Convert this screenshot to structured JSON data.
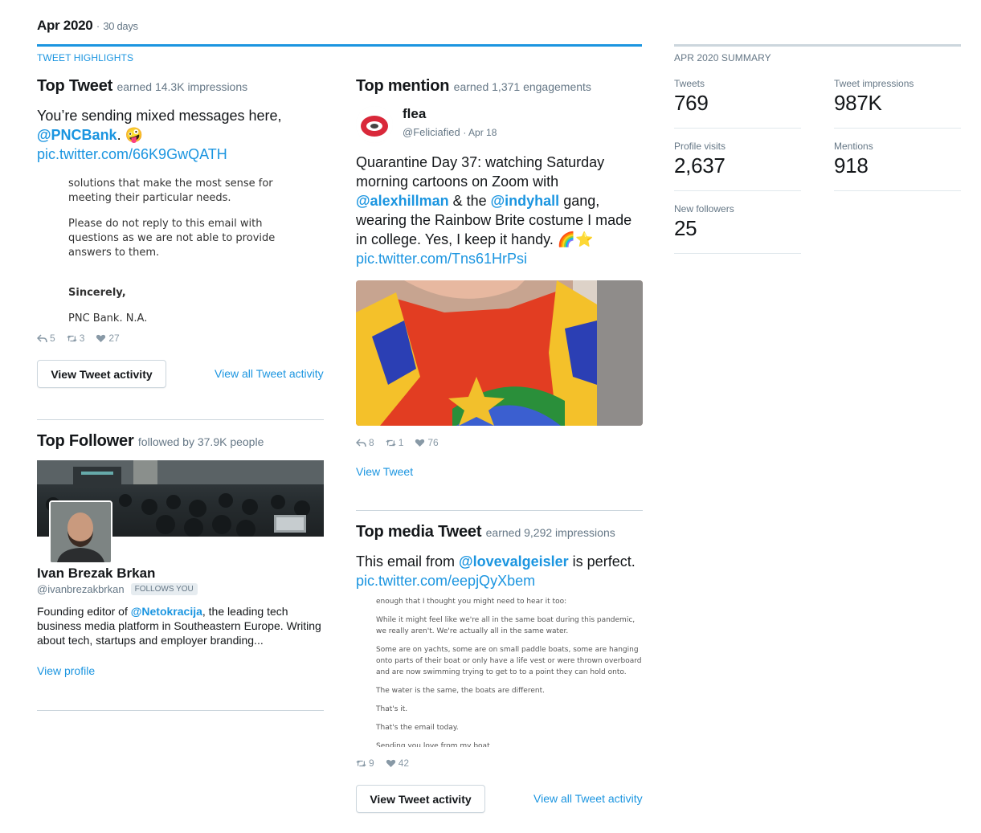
{
  "header": {
    "period": "Apr 2020",
    "separator": "·",
    "days": "30 days"
  },
  "highlights": {
    "section_label": "TWEET HIGHLIGHTS",
    "top_tweet": {
      "title": "Top Tweet",
      "subtitle": "earned 14.3K impressions",
      "text_before": "You’re sending mixed messages here, ",
      "mention": "@PNCBank",
      "text_after": ". 🤪",
      "link": "pic.twitter.com/66K9GwQATH",
      "image_text": [
        "solutions that make the most sense for meeting their particular needs.",
        "Please do not reply to this email with questions as we are not able to provide answers to them.",
        "Sincerely,",
        "PNC Bank, N.A."
      ],
      "replies": "5",
      "retweets": "3",
      "likes": "27",
      "button": "View Tweet activity",
      "all_link": "View all Tweet activity"
    },
    "top_follower": {
      "title": "Top Follower",
      "subtitle": "followed by 37.9K people",
      "name": "Ivan Brezak Brkan",
      "handle": "@ivanbrezakbrkan",
      "badge": "FOLLOWS YOU",
      "bio_before": "Founding editor of ",
      "bio_mention": "@Netokracija",
      "bio_after": ", the leading tech business media platform in Southeastern Europe. Writing about tech, startups and employer branding...",
      "link": "View profile"
    },
    "top_mention": {
      "title": "Top mention",
      "subtitle": "earned 1,371 engagements",
      "name": "flea",
      "handle": "@Feliciafied",
      "date": "· Apr 18",
      "text1": "Quarantine Day 37: watching Saturday morning cartoons on Zoom with ",
      "mention1": "@alexhillman",
      "text2": " & the ",
      "mention2": "@indyhall",
      "text3": " gang, wearing the Rainbow Brite costume I made in college. Yes, I keep it handy. 🌈⭐",
      "link": "pic.twitter.com/Tns61HrPsi",
      "replies": "8",
      "retweets": "1",
      "likes": "76",
      "view_link": "View Tweet"
    },
    "top_media": {
      "title": "Top media Tweet",
      "subtitle": "earned 9,292 impressions",
      "text_before": "This email from ",
      "mention": "@lovevalgeisler",
      "text_after": " is perfect.",
      "link": "pic.twitter.com/eepjQyXbem",
      "image_text": [
        "enough that I thought you might need to hear it too:",
        "While it might feel like we're all in the same boat during this pandemic, we really aren't. We're actually all in the same water.",
        "Some are on yachts, some are on small paddle boats, some are hanging onto parts of their boat or only have a life vest or were thrown overboard and are now swimming trying to get to to a point they can hold onto.",
        "The water is the same, the boats are different.",
        "That's it.",
        "That's the email today.",
        "Sending you love from my boat"
      ],
      "retweets": "9",
      "likes": "42",
      "button": "View Tweet activity",
      "all_link": "View all Tweet activity"
    }
  },
  "summary": {
    "section_label": "APR 2020 SUMMARY",
    "tweets_label": "Tweets",
    "tweets": "769",
    "impressions_label": "Tweet impressions",
    "impressions": "987K",
    "visits_label": "Profile visits",
    "visits": "2,637",
    "mentions_label": "Mentions",
    "mentions": "918",
    "followers_label": "New followers",
    "followers": "25"
  },
  "colors": {
    "accent": "#1b95e0",
    "muted": "#657786",
    "border": "#ccd6dd"
  }
}
